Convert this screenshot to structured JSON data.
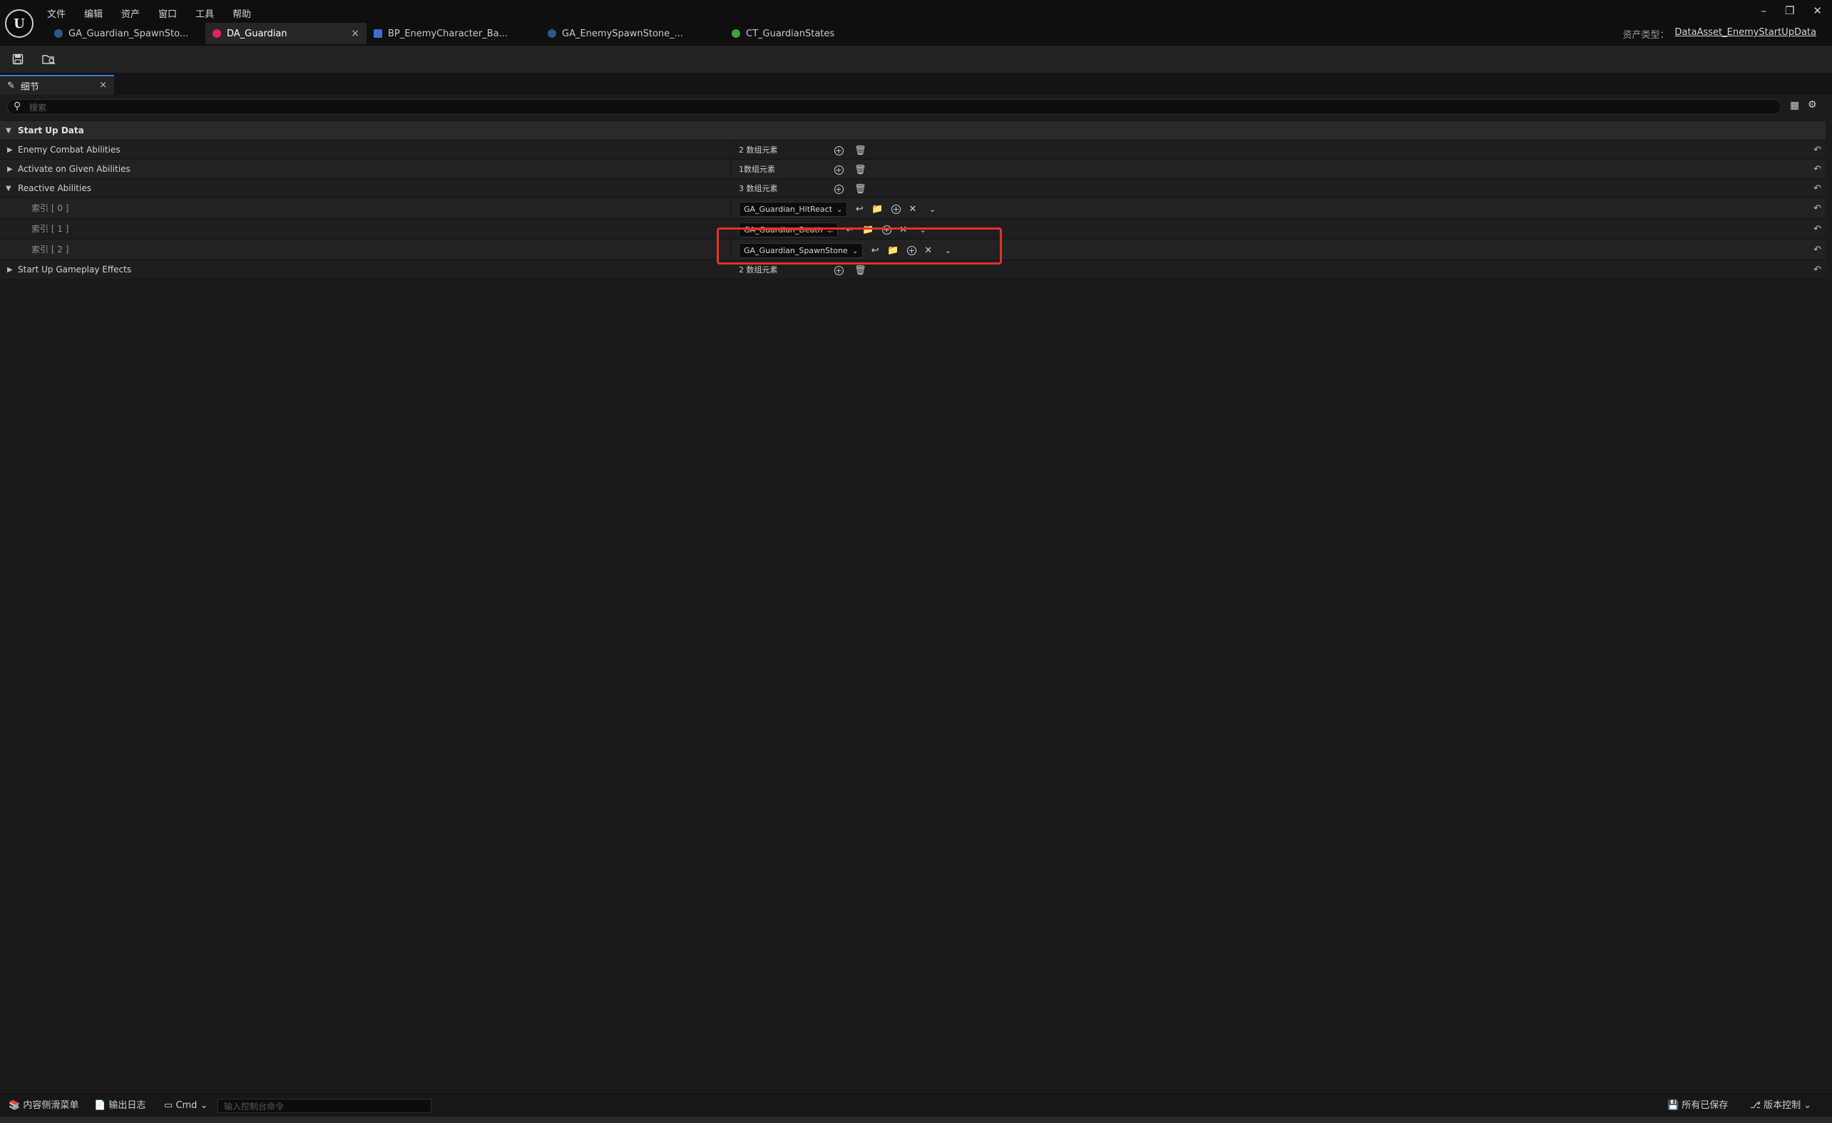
{
  "menu": [
    "文件",
    "编辑",
    "资产",
    "窗口",
    "工具",
    "帮助"
  ],
  "tabs": [
    {
      "label": "GA_Guardian_SpawnSto...",
      "color": "#2a5a8a",
      "active": false
    },
    {
      "label": "DA_Guardian",
      "color": "#e0245e",
      "active": true,
      "close": "×"
    },
    {
      "label": "BP_EnemyCharacter_Ba...",
      "color": "#3b6fd8",
      "active": false
    },
    {
      "label": "GA_EnemySpawnStone_...",
      "color": "#2a5a8a",
      "active": false
    },
    {
      "label": "CT_GuardianStates",
      "color": "#3fa33f",
      "active": false
    }
  ],
  "window_controls": {
    "minimize": "–",
    "restore": "❐",
    "close": "✕"
  },
  "asset_type": {
    "label": "资产类型：",
    "value": "DataAsset_EnemyStartUpData"
  },
  "toolbar": {
    "save_icon": "save-icon",
    "browse_icon": "browse-icon"
  },
  "panel": {
    "tab_label": "细节",
    "close": "×"
  },
  "search": {
    "placeholder": "搜索",
    "value": ""
  },
  "details": {
    "category": "Start Up Data",
    "enemy_combat": {
      "label": "Enemy Combat Abilities",
      "value": "2 数组元素"
    },
    "activate_given": {
      "label": "Activate on Given Abilities",
      "value": "1数组元素"
    },
    "reactive": {
      "label": "Reactive Abilities",
      "value": "3 数组元素"
    },
    "reactive_items": [
      {
        "index": "索引 [ 0 ]",
        "value": "GA_Guardian_HitReact"
      },
      {
        "index": "索引 [ 1 ]",
        "value": "GA_Guardian_Death"
      },
      {
        "index": "索引 [ 2 ]",
        "value": "GA_Guardian_SpawnStone"
      }
    ],
    "startup_effects": {
      "label": "Start Up Gameplay Effects",
      "value": "2 数组元素"
    }
  },
  "statusbar": {
    "content_drawer": "内容侧滑菜单",
    "output_log": "输出日志",
    "cmd": "Cmd",
    "cmd_placeholder": "输入控制台命令",
    "all_saved": "所有已保存",
    "source_control": "版本控制"
  },
  "colors": {
    "highlight": "#e5302d",
    "accent": "#3a7bd5"
  }
}
